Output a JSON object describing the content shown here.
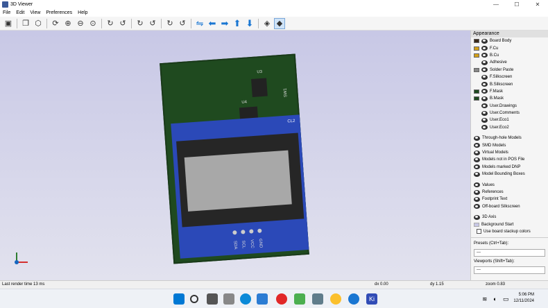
{
  "window": {
    "title": "3D Viewer",
    "minimize": "—",
    "maximize": "☐",
    "close": "✕"
  },
  "menu": [
    "File",
    "Edit",
    "View",
    "Preferences",
    "Help"
  ],
  "toolbar": {
    "icons": [
      "render-icon",
      "copy-icon",
      "board-icon",
      "refresh-icon",
      "zoom-in-icon",
      "zoom-out-icon",
      "zoom-fit-icon",
      "rotate-x-cw-icon",
      "rotate-x-ccw-icon",
      "rotate-y-cw-icon",
      "rotate-y-ccw-icon",
      "rotate-z-cw-icon",
      "rotate-z-ccw-icon",
      "flip-icon",
      "pan-left-icon",
      "pan-right-icon",
      "pan-up-icon",
      "pan-down-icon",
      "ortho-icon",
      "layers-icon"
    ]
  },
  "board_labels": {
    "u3": "U3",
    "u4": "U4",
    "sw1": "SW1",
    "cl2": "CL2",
    "sda": "SDA",
    "scl": "SCL",
    "vcc": "VCC",
    "gnd": "GND"
  },
  "panel": {
    "header": "Appearance",
    "layers": [
      {
        "label": "Board Body",
        "color": "#3a2a1a"
      },
      {
        "label": "F.Cu",
        "color": "#d4a017"
      },
      {
        "label": "B.Cu",
        "color": "#d4a017"
      },
      {
        "label": "Adhesive",
        "color": ""
      },
      {
        "label": "Solder Paste",
        "color": "#888888"
      },
      {
        "label": "F.Silkscreen",
        "color": ""
      },
      {
        "label": "B.Silkscreen",
        "color": ""
      },
      {
        "label": "F.Mask",
        "color": "#1f4a1f"
      },
      {
        "label": "B.Mask",
        "color": "#1f4a1f"
      },
      {
        "label": "User.Drawings",
        "color": ""
      },
      {
        "label": "User.Comments",
        "color": ""
      },
      {
        "label": "User.Eco1",
        "color": ""
      },
      {
        "label": "User.Eco2",
        "color": ""
      }
    ],
    "models": [
      "Through-hole Models",
      "SMD Models",
      "Virtual Models",
      "Models not in POS File",
      "Models marked DNP",
      "Model Bounding Boxes"
    ],
    "texts": [
      "Values",
      "References",
      "Footprint Text",
      "Off-board Silkscreen"
    ],
    "axis": [
      "3D Axis",
      "Background Start"
    ],
    "stackup": "Use board stackup colors",
    "presets_label": "Presets (Ctrl+Tab):",
    "presets_value": "---",
    "viewports_label": "Viewports (Shift+Tab):",
    "viewports_value": "---"
  },
  "status": {
    "render": "Last render time 13 ms",
    "dx": "dx 0.00",
    "dy": "dy 1.15",
    "zoom": "zoom 0.83"
  },
  "clock": {
    "time": "5:06 PM",
    "date": "12/11/2024"
  }
}
